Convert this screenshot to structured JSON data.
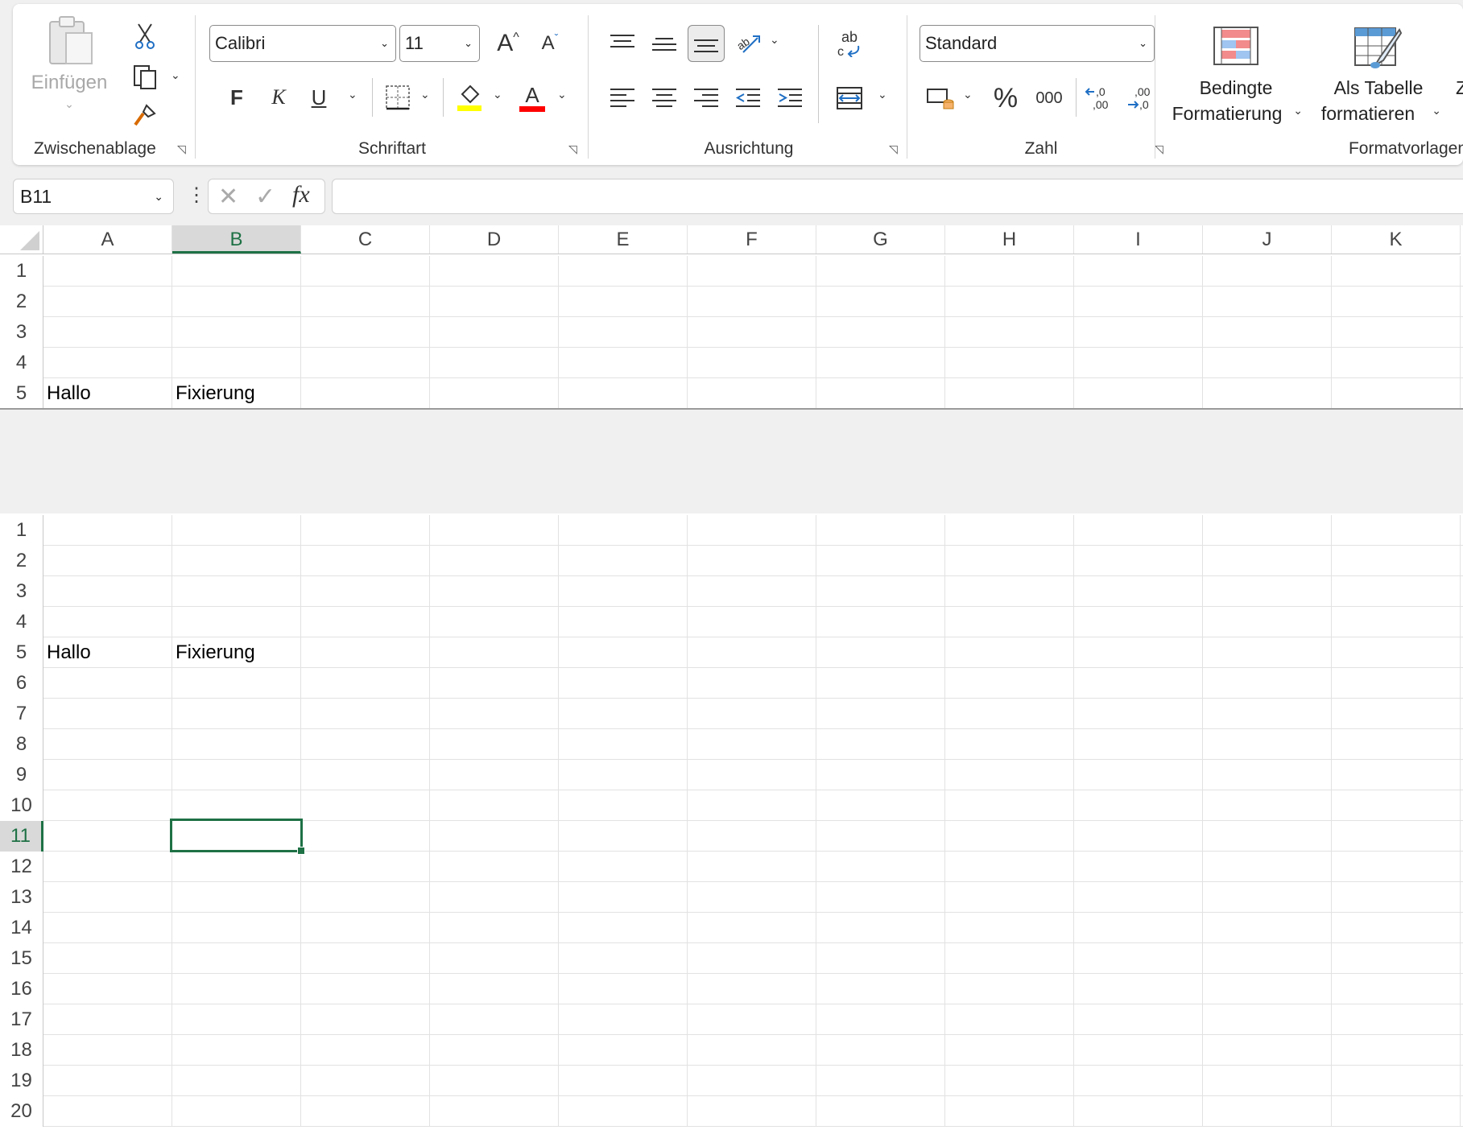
{
  "ribbon": {
    "clipboard": {
      "paste_label": "Einfügen",
      "group_label": "Zwischenablage"
    },
    "font": {
      "font_name": "Calibri",
      "font_size": "11",
      "bold": "F",
      "italic": "K",
      "underline": "U",
      "grow": "A",
      "shrink": "A",
      "font_color_glyph": "A",
      "group_label": "Schriftart",
      "fill_color": "#ffff00",
      "text_color": "#ff0000"
    },
    "alignment": {
      "group_label": "Ausrichtung",
      "wrap_glyph": "ab"
    },
    "number": {
      "format": "Standard",
      "percent": "%",
      "thousands": "000",
      "inc_decimal": "←,0 ,00",
      "dec_decimal": ",00 →,0",
      "group_label": "Zahl"
    },
    "styles": {
      "conditional_line1": "Bedingte",
      "conditional_line2": "Formatierung",
      "table_line1": "Als Tabelle",
      "table_line2": "formatieren",
      "cut_off": "Ze",
      "group_label": "Formatvorlagen"
    }
  },
  "formula_bar": {
    "name_box": "B11",
    "fx": "fx",
    "formula": ""
  },
  "columns": [
    "A",
    "B",
    "C",
    "D",
    "E",
    "F",
    "G",
    "H",
    "I",
    "J",
    "K"
  ],
  "selected_column": "B",
  "top_pane_rows": [
    "1",
    "2",
    "3",
    "4",
    "5"
  ],
  "bottom_pane_rows": [
    "1",
    "2",
    "3",
    "4",
    "5",
    "6",
    "7",
    "8",
    "9",
    "10",
    "11",
    "12",
    "13",
    "14",
    "15",
    "16",
    "17",
    "18",
    "19",
    "20"
  ],
  "selected_row": "11",
  "cells": {
    "A5": "Hallo",
    "B5": "Fixierung"
  },
  "accent_color": "#1e7145"
}
